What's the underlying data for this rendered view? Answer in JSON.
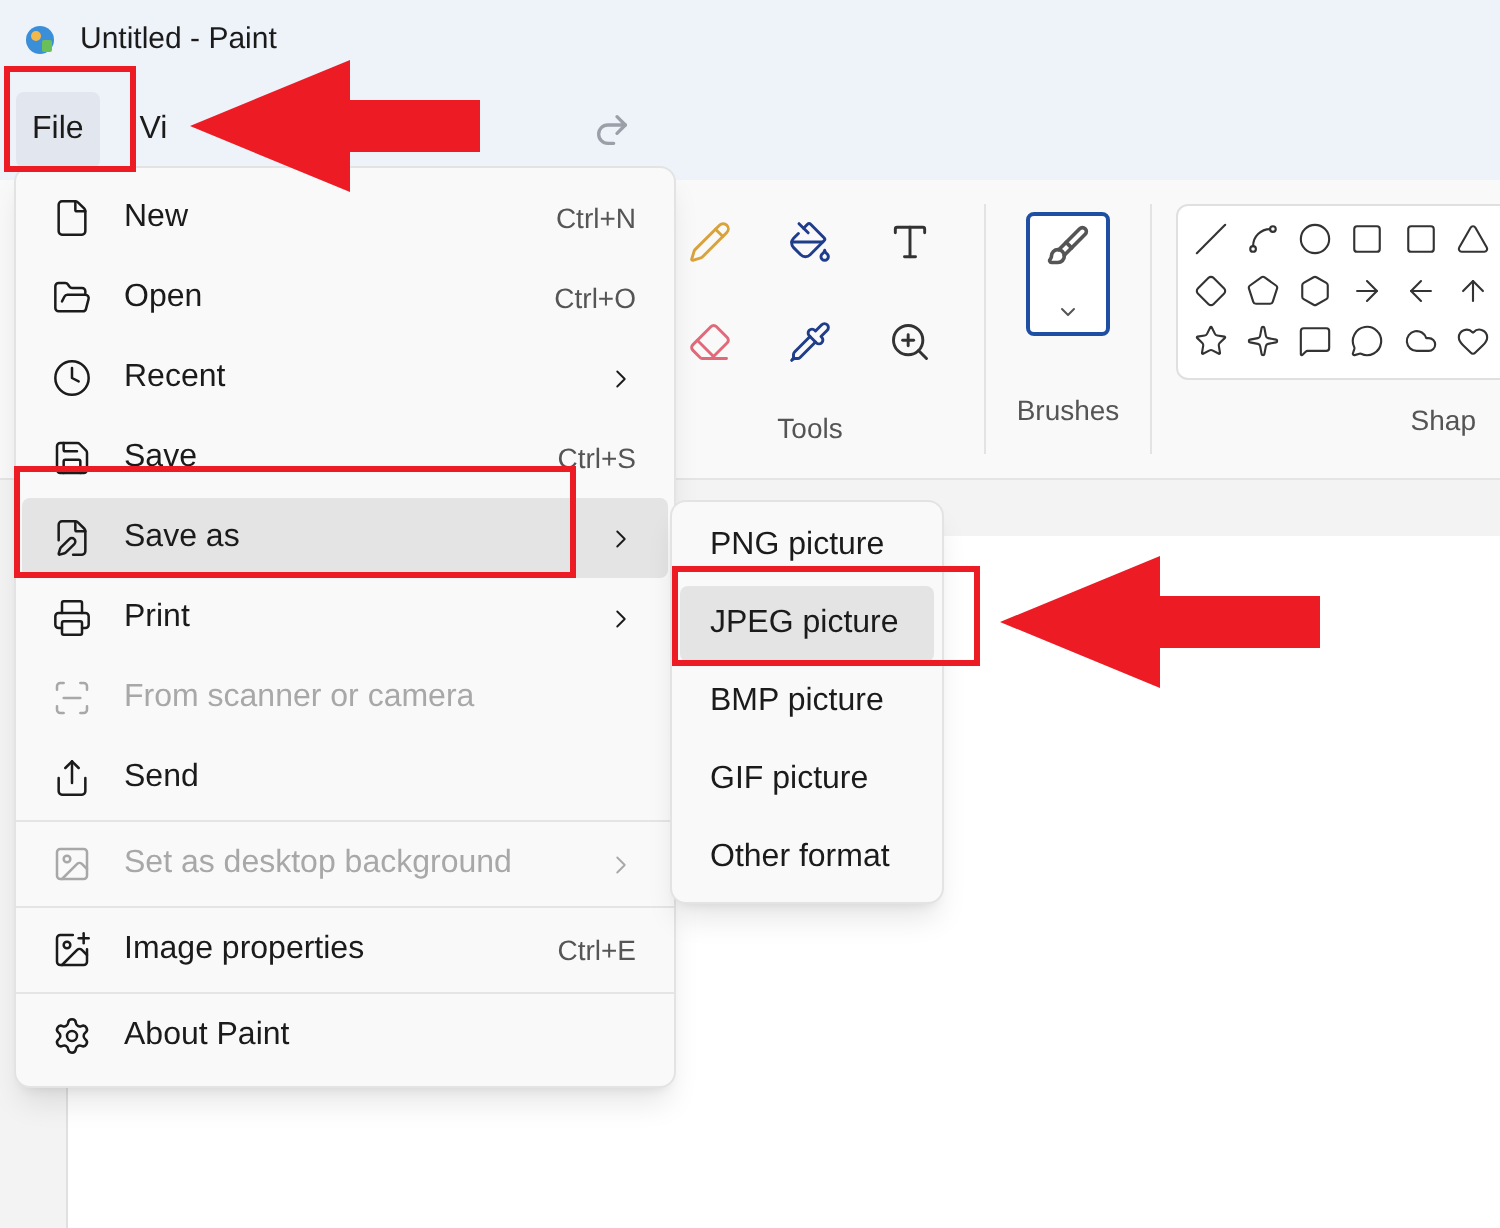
{
  "window": {
    "title": "Untitled - Paint"
  },
  "menu_bar": [
    {
      "label": "File",
      "selected": true
    },
    {
      "label": "Vi",
      "selected": false
    }
  ],
  "file_menu": {
    "items": [
      {
        "kind": "item",
        "label": "New",
        "shortcut": "Ctrl+N",
        "submenu": false,
        "disabled": false,
        "selected": false
      },
      {
        "kind": "item",
        "label": "Open",
        "shortcut": "Ctrl+O",
        "submenu": false,
        "disabled": false,
        "selected": false
      },
      {
        "kind": "item",
        "label": "Recent",
        "submenu": true,
        "disabled": false,
        "selected": false
      },
      {
        "kind": "item",
        "label": "Save",
        "shortcut": "Ctrl+S",
        "submenu": false,
        "disabled": false,
        "selected": false
      },
      {
        "kind": "item",
        "label": "Save as",
        "submenu": true,
        "disabled": false,
        "selected": true
      },
      {
        "kind": "item",
        "label": "Print",
        "submenu": true,
        "disabled": false,
        "selected": false
      },
      {
        "kind": "item",
        "label": "From scanner or camera",
        "submenu": false,
        "disabled": true,
        "selected": false
      },
      {
        "kind": "item",
        "label": "Send",
        "submenu": false,
        "disabled": false,
        "selected": false
      },
      {
        "kind": "separator"
      },
      {
        "kind": "item",
        "label": "Set as desktop background",
        "submenu": true,
        "disabled": true,
        "selected": false
      },
      {
        "kind": "separator"
      },
      {
        "kind": "item",
        "label": "Image properties",
        "shortcut": "Ctrl+E",
        "submenu": false,
        "disabled": false,
        "selected": false
      },
      {
        "kind": "separator"
      },
      {
        "kind": "item",
        "label": "About Paint",
        "submenu": false,
        "disabled": false,
        "selected": false
      }
    ]
  },
  "save_as_menu": {
    "items": [
      {
        "label": "PNG picture",
        "selected": false
      },
      {
        "label": "JPEG picture",
        "selected": true
      },
      {
        "label": "BMP picture",
        "selected": false
      },
      {
        "label": "GIF picture",
        "selected": false
      },
      {
        "label": "Other format",
        "selected": false
      }
    ]
  },
  "ribbon": {
    "groups": [
      {
        "label": "Tools"
      },
      {
        "label": "Brushes"
      },
      {
        "label": "Shap"
      }
    ]
  }
}
